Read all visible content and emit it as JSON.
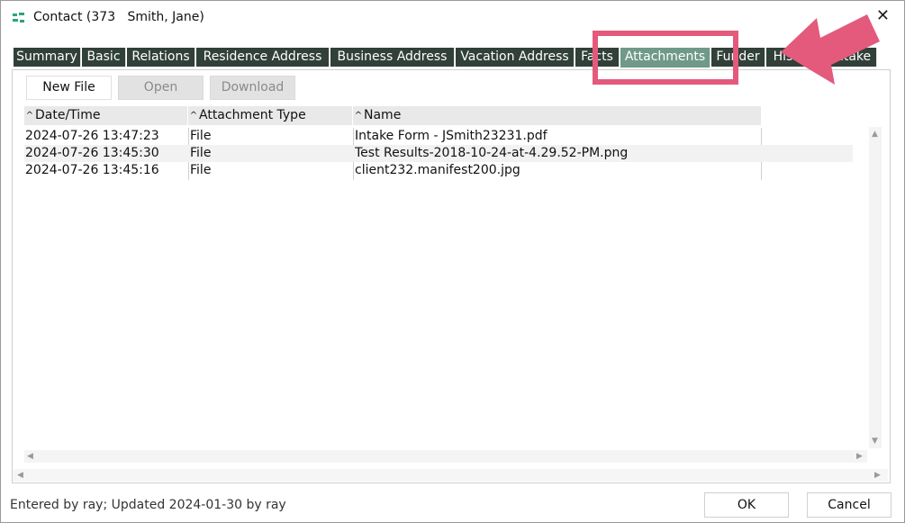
{
  "window": {
    "title": "Contact (373   Smith, Jane)",
    "close_glyph": "✕"
  },
  "tabs": [
    {
      "label": "Summary",
      "active": false
    },
    {
      "label": "Basic",
      "active": false
    },
    {
      "label": "Relations",
      "active": false
    },
    {
      "label": "Residence Address",
      "active": false
    },
    {
      "label": "Business Address",
      "active": false
    },
    {
      "label": "Vacation Address",
      "active": false
    },
    {
      "label": "Facts",
      "active": false
    },
    {
      "label": "Attachments",
      "active": true
    },
    {
      "label": "Funder",
      "active": false
    },
    {
      "label": "History",
      "active": false
    },
    {
      "label": "Intake",
      "active": false
    }
  ],
  "toolbar": {
    "new_file": "New File",
    "open": "Open",
    "download": "Download"
  },
  "table": {
    "sort_glyph": "^",
    "columns": [
      "Date/Time",
      "Attachment Type",
      "Name"
    ],
    "rows": [
      {
        "datetime": "2024-07-26 13:47:23",
        "type": "File",
        "name": "Intake Form - JSmith23231.pdf"
      },
      {
        "datetime": "2024-07-26 13:45:30",
        "type": "File",
        "name": "Test Results-2018-10-24-at-4.29.52-PM.png"
      },
      {
        "datetime": "2024-07-26 13:45:16",
        "type": "File",
        "name": "client232.manifest200.jpg"
      }
    ]
  },
  "status_text": "Entered by ray; Updated 2024-01-30 by ray",
  "footer": {
    "ok": "OK",
    "cancel": "Cancel"
  },
  "colors": {
    "tab_bg": "#314039",
    "tab_active_bg": "#6f9989",
    "annotation": "#e35a7c",
    "app_icon": "#2aa37f"
  }
}
